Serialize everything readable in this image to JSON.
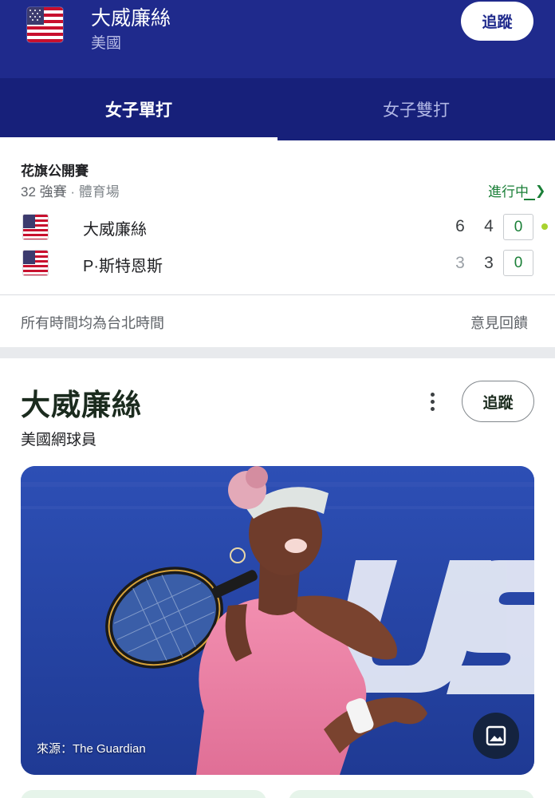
{
  "header": {
    "player_name": "大威廉絲",
    "country": "美國",
    "follow_label": "追蹤",
    "flag_icon": "us-flag-icon"
  },
  "tabs": [
    {
      "label": "女子單打",
      "active": true
    },
    {
      "label": "女子雙打",
      "active": false
    }
  ],
  "match": {
    "tournament": "花旗公開賽",
    "round": "32 強賽",
    "venue": "體育場",
    "status": "進行中",
    "players": [
      {
        "name": "大威廉絲",
        "sets": [
          "6",
          "4"
        ],
        "game": "0",
        "serving": true
      },
      {
        "name": "P·斯特恩斯",
        "sets": [
          "3",
          "3"
        ],
        "game": "0",
        "serving": false
      }
    ],
    "colors": {
      "live": "#1a7f37",
      "serve_dot": "#a8d22f"
    }
  },
  "footer": {
    "timezone_note": "所有時間均為台北時間",
    "feedback_label": "意見回饋"
  },
  "knowledge_panel": {
    "title": "大威廉絲",
    "subtitle": "美國網球員",
    "follow_label": "追蹤",
    "more_icon": "more-vert-icon",
    "photo_credit": "來源：The Guardian",
    "photo_watermark": "US",
    "image_icon": "image-icon"
  },
  "theme": {
    "header_bg": "#1f2a8c",
    "tabbar_bg": "#17207a"
  }
}
